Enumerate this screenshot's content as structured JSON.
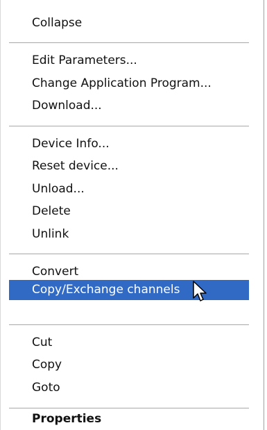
{
  "menu": {
    "groups": [
      [
        "Collapse"
      ],
      [
        "Edit Parameters...",
        "Change Application Program...",
        "Download..."
      ],
      [
        "Device Info...",
        "Reset device...",
        "Unload...",
        "Delete",
        "Unlink"
      ],
      [
        "Convert",
        "Copy/Exchange channels"
      ],
      [
        "Cut",
        "Copy",
        "Goto"
      ],
      [
        "Properties"
      ]
    ],
    "selected": "Copy/Exchange channels",
    "bold": "Properties",
    "selected_color": "#316ac5"
  },
  "cursor": {
    "icon": "arrow-cursor-icon"
  }
}
